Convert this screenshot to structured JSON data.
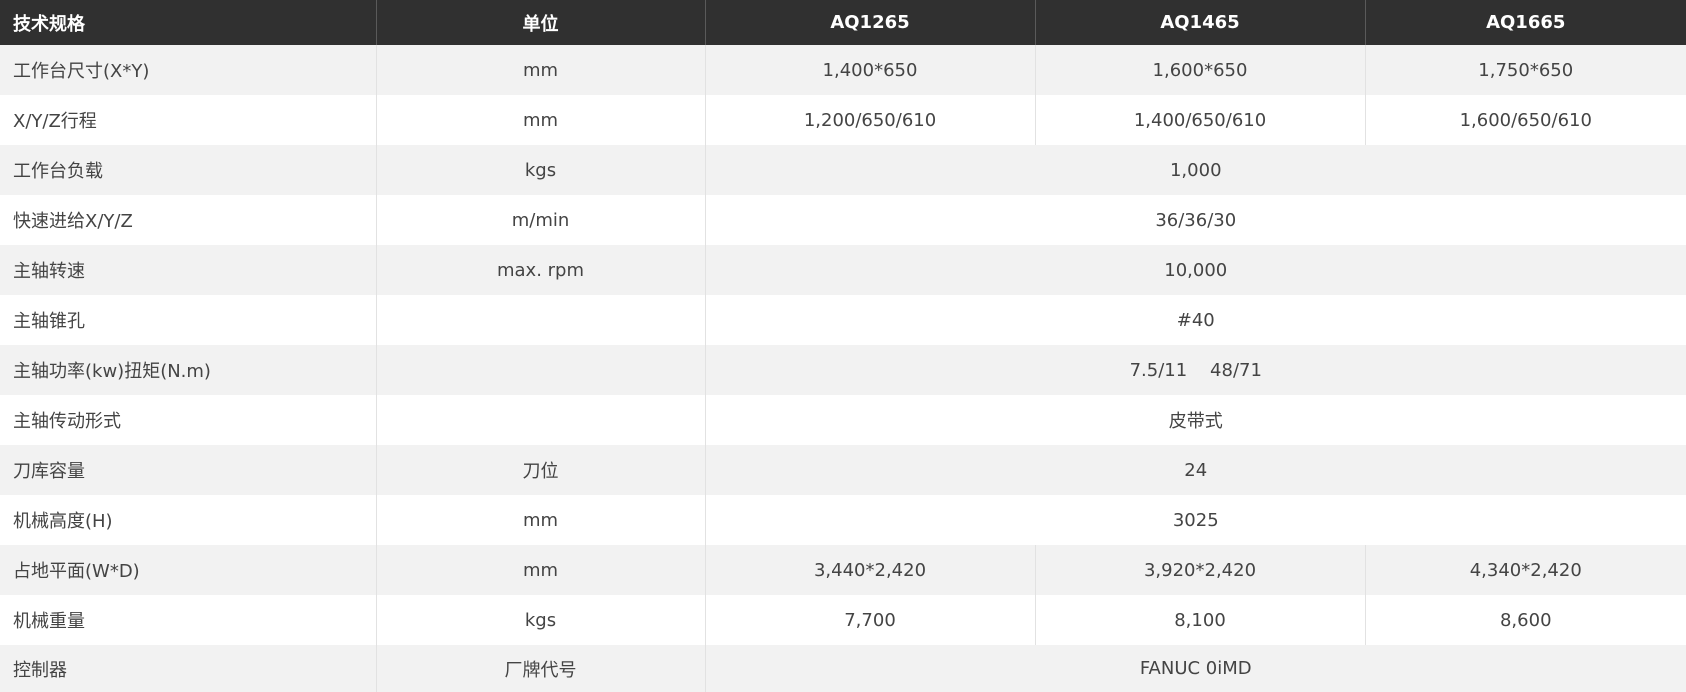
{
  "header": {
    "spec": "技术规格",
    "unit": "单位",
    "model1": "AQ1265",
    "model2": "AQ1465",
    "model3": "AQ1665"
  },
  "rows": [
    {
      "label": "工作台尺寸(X*Y)",
      "unit": "mm",
      "v1": "1,400*650",
      "v2": "1,600*650",
      "v3": "1,750*650"
    },
    {
      "label": "X/Y/Z行程",
      "unit": "mm",
      "v1": "1,200/650/610",
      "v2": "1,400/650/610",
      "v3": "1,600/650/610"
    },
    {
      "label": "工作台负载",
      "unit": "kgs",
      "value": "1,000"
    },
    {
      "label": "快速进给X/Y/Z",
      "unit": "m/min",
      "value": "36/36/30"
    },
    {
      "label": "主轴转速",
      "unit": "max. rpm",
      "value": "10,000"
    },
    {
      "label": "主轴锥孔",
      "unit": "",
      "value": "#40"
    },
    {
      "label": "主轴功率(kw)扭矩(N.m)",
      "unit": "",
      "value": "7.5/11    48/71"
    },
    {
      "label": "主轴传动形式",
      "unit": "",
      "value": "皮带式"
    },
    {
      "label": "刀库容量",
      "unit": "刀位",
      "value": "24"
    },
    {
      "label": "机械高度(H)",
      "unit": "mm",
      "value": "3025"
    },
    {
      "label": "占地平面(W*D)",
      "unit": "mm",
      "v1": "3,440*2,420",
      "v2": "3,920*2,420",
      "v3": "4,340*2,420"
    },
    {
      "label": "机械重量",
      "unit": "kgs",
      "v1": "7,700",
      "v2": "8,100",
      "v3": "8,600"
    },
    {
      "label": "控制器",
      "unit": "厂牌代号",
      "value": "FANUC 0iMD"
    }
  ]
}
